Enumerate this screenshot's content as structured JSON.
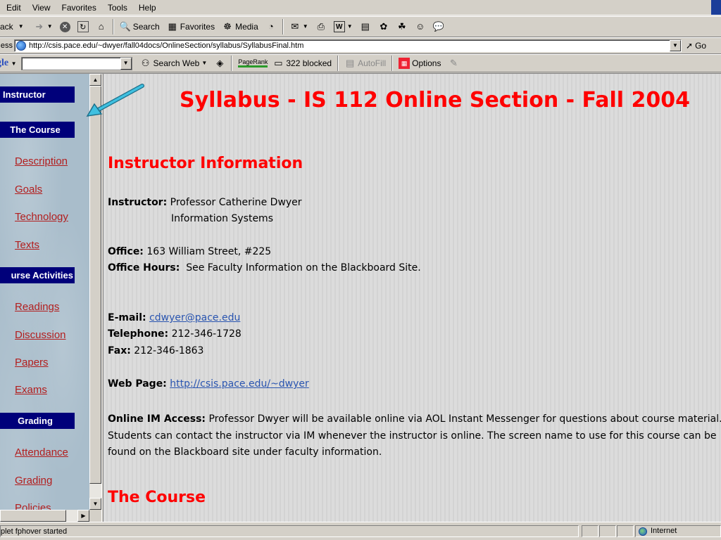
{
  "menu": [
    "Edit",
    "View",
    "Favorites",
    "Tools",
    "Help"
  ],
  "toolbar": {
    "back": "ack",
    "search": "Search",
    "favorites": "Favorites",
    "media": "Media"
  },
  "address": {
    "label": "ess",
    "url": "http://csis.pace.edu/~dwyer/fall04docs/OnlineSection/syllabus/SyllabusFinal.htm",
    "go": "Go"
  },
  "googlebar": {
    "logo": "gle",
    "search_web": "Search Web",
    "pagerank": "PageRank",
    "blocked": "322 blocked",
    "autofill": "AutoFill",
    "options": "Options"
  },
  "sidebar": {
    "sections": [
      {
        "heading": "Instructor",
        "links": []
      },
      {
        "heading": "The Course",
        "links": [
          "Description",
          "Goals",
          "Technology",
          "Texts"
        ]
      },
      {
        "heading": "urse Activities",
        "links": [
          "Readings",
          "Discussion",
          "Papers",
          "Exams"
        ]
      },
      {
        "heading": "Grading",
        "links": [
          "Attendance",
          "Grading",
          "Policies"
        ]
      }
    ]
  },
  "content": {
    "title": "Syllabus - IS 112 Online Section - Fall 2004",
    "instructor_heading": "Instructor Information",
    "instructor_label": "Instructor:",
    "instructor_name": "Professor Catherine Dwyer",
    "instructor_dept": "Information Systems",
    "office_label": "Office:",
    "office_value": "163 William Street, #225",
    "hours_label": "Office Hours:",
    "hours_value": "See Faculty Information on the Blackboard Site.",
    "email_label": "E-mail:",
    "email_value": "cdwyer@pace.edu",
    "phone_label": "Telephone:",
    "phone_value": "212-346-1728",
    "fax_label": "Fax:",
    "fax_value": "212-346-1863",
    "web_label": "Web Page:",
    "web_value": "http://csis.pace.edu/~dwyer",
    "im_label": "Online IM Access:",
    "im_text": "Professor Dwyer will be available online via AOL Instant Messenger for questions about course material. Students can contact the instructor via IM whenever the instructor is online. The screen name to use for this course can be found on the Blackboard site under faculty information.",
    "course_heading": "The Course"
  },
  "status": {
    "text": "plet fphover started",
    "zone": "Internet"
  },
  "colors": {
    "heading_red": "#ff0000",
    "link_red": "#b21e1e",
    "nav_blue": "#00007a",
    "link_blue": "#2a55b0",
    "arrow": "#2aa6c7"
  }
}
